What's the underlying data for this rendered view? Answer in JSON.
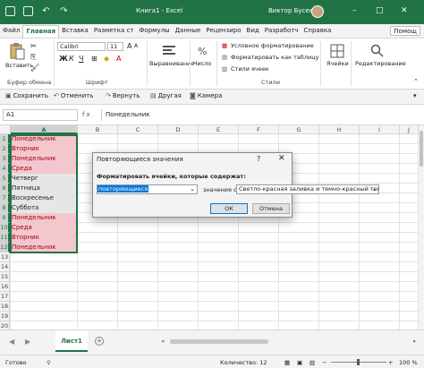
{
  "titlebar": {
    "autosave_icon": "save-icon",
    "title": "Книга1 - Excel",
    "user": "Виктор Бусеев",
    "controls": [
      "–",
      "□",
      "✕"
    ]
  },
  "tabs": [
    {
      "label": "Файл"
    },
    {
      "label": "Главная"
    },
    {
      "label": "Вставка"
    },
    {
      "label": "Разметка ст"
    },
    {
      "label": "Формулы"
    },
    {
      "label": "Данные"
    },
    {
      "label": "Рецензиро"
    },
    {
      "label": "Вид"
    },
    {
      "label": "Разработч"
    },
    {
      "label": "Справка"
    }
  ],
  "share_label": "Помощ",
  "ribbon": {
    "paste": "Вставить",
    "clipboard": "Буфер обмена",
    "font_name": "Calibri",
    "font_size": "11",
    "bold": "Ж",
    "italic": "К",
    "underline": "Ч",
    "font": "Шрифт",
    "alignment": "Выравнивание",
    "number": "Число",
    "cond_format": "Условное форматирование",
    "format_table": "Форматировать как таблицу",
    "cell_styles": "Стили ячеек",
    "styles": "Стили",
    "cells": "Ячейки",
    "editing": "Редактирование"
  },
  "qat": {
    "save": "Сохранить",
    "undo": "Отменить",
    "redo": "Вернуть",
    "other": "Другая",
    "camera": "Камера"
  },
  "formula_bar": {
    "name_box": "A1",
    "fx": "fx",
    "value": "Понедельник"
  },
  "columns": [
    "A",
    "B",
    "C",
    "D",
    "E",
    "F",
    "G",
    "H",
    "I",
    "J"
  ],
  "rows": [
    {
      "num": "1",
      "value": "Понедельник",
      "duplicate": true
    },
    {
      "num": "2",
      "value": "Вторник",
      "duplicate": true
    },
    {
      "num": "3",
      "value": "Понедельник",
      "duplicate": true
    },
    {
      "num": "4",
      "value": "Среда",
      "duplicate": true
    },
    {
      "num": "5",
      "value": "Четверг",
      "duplicate": false
    },
    {
      "num": "6",
      "value": "Пятница",
      "duplicate": false
    },
    {
      "num": "7",
      "value": "Воскресенье",
      "duplicate": false
    },
    {
      "num": "8",
      "value": "Суббота",
      "duplicate": false
    },
    {
      "num": "9",
      "value": "Понедельник",
      "duplicate": true
    },
    {
      "num": "10",
      "value": "Среда",
      "duplicate": true
    },
    {
      "num": "11",
      "value": "Вторник",
      "duplicate": true
    },
    {
      "num": "12",
      "value": "Понедельник",
      "duplicate": true
    },
    {
      "num": "13",
      "value": "",
      "duplicate": false
    },
    {
      "num": "14",
      "value": "",
      "duplicate": false
    },
    {
      "num": "15",
      "value": "",
      "duplicate": false
    },
    {
      "num": "16",
      "value": "",
      "duplicate": false
    },
    {
      "num": "17",
      "value": "",
      "duplicate": false
    },
    {
      "num": "18",
      "value": "",
      "duplicate": false
    },
    {
      "num": "19",
      "value": "",
      "duplicate": false
    },
    {
      "num": "20",
      "value": "",
      "duplicate": false
    }
  ],
  "dialog": {
    "title": "Повторяющиеся значения",
    "help": "?",
    "close": "✕",
    "label": "Форматировать ячейки, которые содержат:",
    "type_value": "повторяющиеся",
    "middle": "значения с",
    "format_value": "Светло-красная заливка и темно-красный текст",
    "ok": "ОК",
    "cancel": "Отмена"
  },
  "sheet_tab": "Лист1",
  "status": {
    "ready": "Готово",
    "count": "Количество: 12",
    "zoom": "100 %"
  },
  "colors": {
    "accent": "#217346",
    "duplicate_fill": "#f4c7ce",
    "duplicate_text": "#9c0006"
  }
}
